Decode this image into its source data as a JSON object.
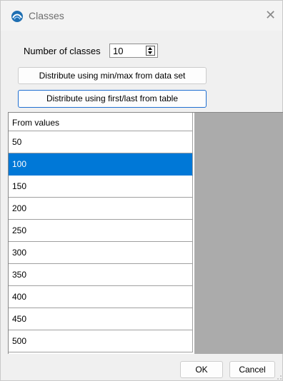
{
  "window": {
    "title": "Classes",
    "icon": "map-layer-icon",
    "close_icon": "close-icon"
  },
  "number_of_classes": {
    "label": "Number of classes",
    "value": "10"
  },
  "buttons": {
    "distribute_minmax": "Distribute using min/max from data set",
    "distribute_firstlast": "Distribute using first/last from table",
    "ok": "OK",
    "cancel": "Cancel"
  },
  "table": {
    "header": "From values",
    "rows": [
      "50",
      "100",
      "150",
      "200",
      "250",
      "300",
      "350",
      "400",
      "450",
      "500"
    ],
    "selected_row_value": "100"
  },
  "colors": {
    "selection": "#0078d7",
    "focus_border": "#1f6fd1",
    "grid_background": "#ababab"
  }
}
